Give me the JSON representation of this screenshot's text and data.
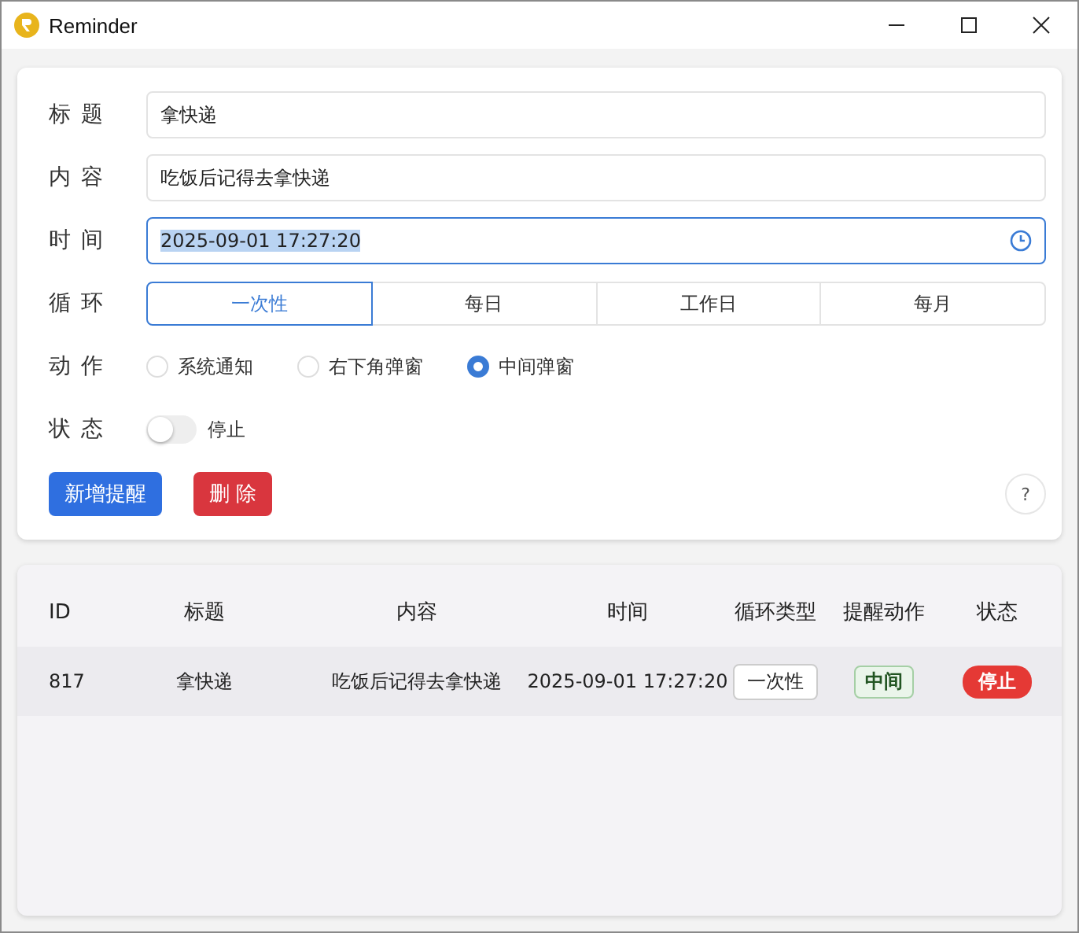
{
  "window": {
    "title": "Reminder"
  },
  "form": {
    "fields": [
      {
        "kind": "text",
        "label": "标题",
        "value": "拿快递"
      },
      {
        "kind": "text",
        "label": "内容",
        "value": "吃饭后记得去拿快递"
      },
      {
        "kind": "time",
        "label": "时间",
        "value": "2025-09-01 17:27:20",
        "text_selected": true
      }
    ],
    "repeat": {
      "label": "循环",
      "options": [
        {
          "label": "一次性",
          "selected": true
        },
        {
          "label": "每日",
          "selected": false
        },
        {
          "label": "工作日",
          "selected": false
        },
        {
          "label": "每月",
          "selected": false
        }
      ]
    },
    "action": {
      "label": "动作",
      "options": [
        {
          "label": "系统通知",
          "selected": false
        },
        {
          "label": "右下角弹窗",
          "selected": false
        },
        {
          "label": "中间弹窗",
          "selected": true
        }
      ]
    },
    "status": {
      "label": "状态",
      "on": false,
      "text": "停止"
    },
    "buttons": [
      {
        "kind": "primary",
        "label": "新增提醒"
      },
      {
        "kind": "danger",
        "label": "删 除"
      }
    ],
    "help": "?"
  },
  "table": {
    "columns": [
      "ID",
      "标题",
      "内容",
      "时间",
      "循环类型",
      "提醒动作",
      "状态"
    ],
    "rows": [
      [
        {
          "kind": "text",
          "text": "817"
        },
        {
          "kind": "text",
          "text": "拿快递"
        },
        {
          "kind": "text",
          "text": "吃饭后记得去拿快递"
        },
        {
          "kind": "text",
          "text": "2025-09-01 17:27:20"
        },
        {
          "kind": "outline-tag",
          "text": "一次性"
        },
        {
          "kind": "green-tag",
          "text": "中间"
        },
        {
          "kind": "red-tag",
          "text": "停止"
        }
      ]
    ]
  }
}
